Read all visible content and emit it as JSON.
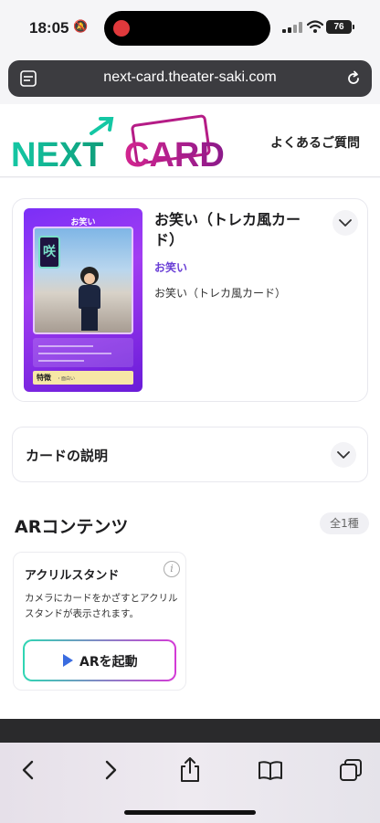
{
  "status_bar": {
    "time": "18:05",
    "battery": "76"
  },
  "browser": {
    "url": "next-card.theater-saki.com"
  },
  "header": {
    "logo_text_1": "NEXT",
    "logo_text_2": "CARD",
    "faq_label": "よくあるご質問"
  },
  "product": {
    "title": "お笑い（トレカ風カード）",
    "category": "お笑い",
    "description": "お笑い（トレカ風カード）",
    "card_image": {
      "title": "お笑い",
      "emblem": "咲",
      "feature_label": "特徴",
      "feature_value": "・面白い"
    }
  },
  "card_description": {
    "label": "カードの説明"
  },
  "ar": {
    "heading": "ARコンテンツ",
    "count": "全1種",
    "items": [
      {
        "title": "アクリルスタンド",
        "description": "カメラにカードをかざすとアクリルスタンドが表示されます。",
        "button_label": "ARを起動"
      }
    ]
  },
  "colors": {
    "accent_purple": "#6a3fd6",
    "logo_green": "#19c9a0",
    "logo_magenta": "#c81e8c"
  },
  "toolbar_icons": [
    "back-icon",
    "forward-icon",
    "share-icon",
    "bookmarks-icon",
    "tabs-icon"
  ]
}
